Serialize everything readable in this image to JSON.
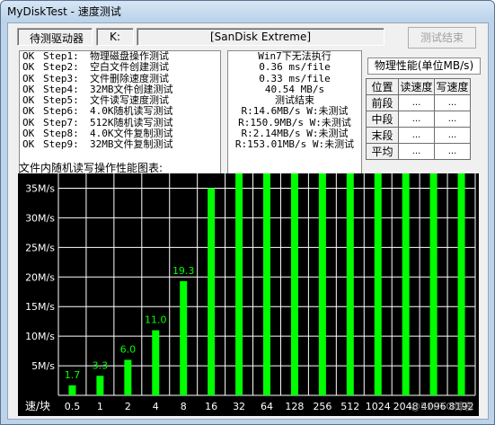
{
  "window": {
    "title": "MyDiskTest - 速度测试"
  },
  "top": {
    "drive_label": "待测驱动器",
    "drive_letter": "K:",
    "device_name": "[SanDisk Extreme]",
    "end_button": "测试结束"
  },
  "steps": [
    {
      "status": "OK",
      "step": "Step1:",
      "desc": "物理磁盘操作测试"
    },
    {
      "status": "OK",
      "step": "Step2:",
      "desc": "空白文件创建测试"
    },
    {
      "status": "OK",
      "step": "Step3:",
      "desc": "文件删除速度测试"
    },
    {
      "status": "OK",
      "step": "Step4:",
      "desc": "32MB文件创建测试"
    },
    {
      "status": "OK",
      "step": "Step5:",
      "desc": "文件读写速度测试"
    },
    {
      "status": "OK",
      "step": "Step6:",
      "desc": "4.0K随机读写测试"
    },
    {
      "status": "OK",
      "step": "Step7:",
      "desc": "512K随机读写测试"
    },
    {
      "status": "OK",
      "step": "Step8:",
      "desc": "4.0K文件复制测试"
    },
    {
      "status": "OK",
      "step": "Step9:",
      "desc": "32MB文件复制测试"
    }
  ],
  "results": [
    "Win7下无法执行",
    "0.36 ms/file",
    "0.33 ms/file",
    "40.54 MB/s",
    "测试结束",
    "R:14.6MB/s W:未测试",
    "R:150.9MB/s W:未测试",
    "R:2.14MB/s W:未测试",
    "R:153.01MB/s W:未测试"
  ],
  "perf": {
    "title": "物理性能(单位MB/s)",
    "headers": [
      "位置",
      "读速度",
      "写速度"
    ],
    "rows": [
      {
        "pos": "前段",
        "read": "...",
        "write": "..."
      },
      {
        "pos": "中段",
        "read": "...",
        "write": "..."
      },
      {
        "pos": "末段",
        "read": "...",
        "write": "..."
      },
      {
        "pos": "平均",
        "read": "...",
        "write": "..."
      }
    ]
  },
  "chart_label": "文件内随机读写操作性能图表:",
  "chart_data": {
    "type": "bar",
    "x_axis_label": "速/块",
    "categories": [
      "0.5",
      "1",
      "2",
      "4",
      "8",
      "16",
      "32",
      "64",
      "128",
      "256",
      "512",
      "1024",
      "2048",
      "4096",
      "8192"
    ],
    "values": [
      1.7,
      3.3,
      6.0,
      11.0,
      19.3,
      35,
      40,
      40,
      40,
      40,
      40,
      40,
      40,
      40,
      40
    ],
    "data_labels": [
      "1.7",
      "3.3",
      "6.0",
      "11.0",
      "19.3",
      "",
      "",
      "",
      "",
      "",
      "",
      "",
      "",
      "",
      ""
    ],
    "y_ticks": [
      "5M/s",
      "10M/s",
      "15M/s",
      "20M/s",
      "25M/s",
      "30M/s",
      "35M/s"
    ],
    "y_tick_values": [
      5,
      10,
      15,
      20,
      25,
      30,
      35
    ],
    "ylim": [
      0,
      37.5
    ],
    "bar_color": "#00ff00",
    "label_color": "#00ff00",
    "background": "#000000",
    "grid": true
  },
  "watermark": "@51CTO博客"
}
